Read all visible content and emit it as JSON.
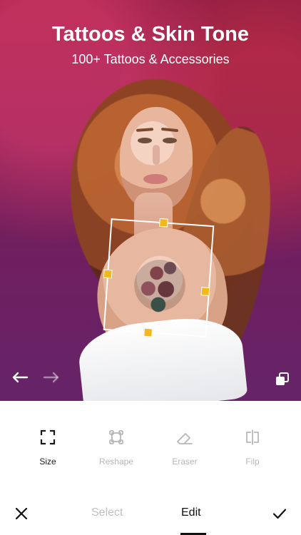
{
  "header": {
    "title": "Tattoos & Skin Tone",
    "subtitle": "100+ Tattoos & Accessories"
  },
  "canvas": {
    "prev_icon": "arrow-left-icon",
    "next_icon": "arrow-right-icon",
    "layers_icon": "layers-icon"
  },
  "tools": [
    {
      "label": "Size",
      "icon": "resize-icon",
      "active": true
    },
    {
      "label": "Reshape",
      "icon": "reshape-icon",
      "active": false
    },
    {
      "label": "Eraser",
      "icon": "eraser-icon",
      "active": false
    },
    {
      "label": "Filp",
      "icon": "flip-icon",
      "active": false
    }
  ],
  "bottom_bar": {
    "cancel_icon": "close-icon",
    "select_label": "Select",
    "edit_label": "Edit",
    "confirm_icon": "check-icon"
  },
  "colors": {
    "handle": "#f2b81c",
    "active_text": "#111111",
    "inactive_text": "#b7b7b7"
  }
}
